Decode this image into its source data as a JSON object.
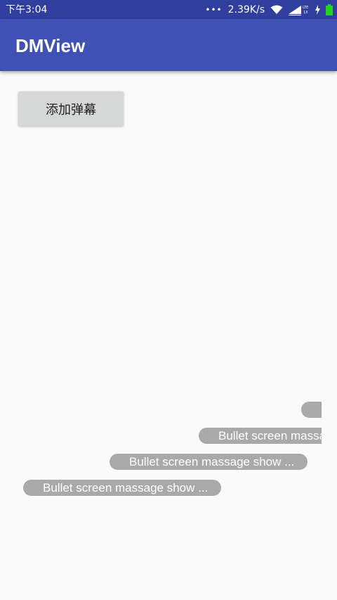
{
  "status_bar": {
    "time": "下午3:04",
    "dots": "•••",
    "speed": "2.39K/s",
    "icons": [
      "wifi-icon",
      "signal-lte-icon",
      "charging-icon",
      "battery-icon"
    ],
    "colors": {
      "background": "#303f9f",
      "battery": "#22d322"
    }
  },
  "app_bar": {
    "title": "DMView",
    "color": "#3f51b5"
  },
  "main": {
    "add_button_label": "添加弹幕"
  },
  "danmaku": {
    "items": [
      {
        "text": ""
      },
      {
        "text": "Bullet screen massage show ..."
      },
      {
        "text": "Bullet screen massage show ..."
      },
      {
        "text": "Bullet screen massage show ..."
      }
    ],
    "bullet_color": "#a9a9a9"
  }
}
